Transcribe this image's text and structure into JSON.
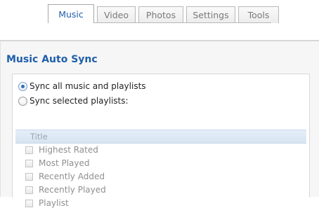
{
  "tabs": [
    {
      "label": "Music",
      "active": true
    },
    {
      "label": "Video",
      "active": false
    },
    {
      "label": "Photos",
      "active": false
    },
    {
      "label": "Settings",
      "active": false
    },
    {
      "label": "Tools",
      "active": false
    }
  ],
  "section": {
    "title": "Music Auto Sync"
  },
  "sync_options": [
    {
      "label": "Sync all music and playlists",
      "selected": true
    },
    {
      "label": "Sync selected playlists:",
      "selected": false
    }
  ],
  "playlist_table": {
    "header": "Title",
    "rows": [
      {
        "label": "Highest Rated",
        "checked": false
      },
      {
        "label": "Most Played",
        "checked": false
      },
      {
        "label": "Recently Added",
        "checked": false
      },
      {
        "label": "Recently Played",
        "checked": false
      },
      {
        "label": "Playlist",
        "checked": false
      }
    ]
  },
  "colors": {
    "accent": "#1f5faa",
    "header_bg": "#dbe7f4",
    "disabled_text": "#8f8f8f"
  }
}
